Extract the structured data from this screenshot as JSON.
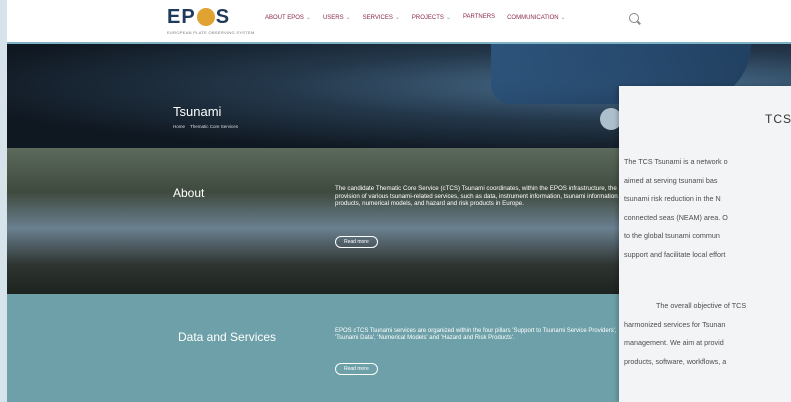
{
  "header": {
    "logo": "EPOS",
    "logo_subtitle": "EUROPEAN PLATE OBSERVING SYSTEM",
    "nav": [
      {
        "label": "ABOUT EPOS",
        "chevron": "⌄"
      },
      {
        "label": "USERS",
        "chevron": "⌄"
      },
      {
        "label": "SERVICES",
        "chevron": "⌄"
      },
      {
        "label": "PROJECTS",
        "chevron": "⌄"
      },
      {
        "label": "PARTNERS",
        "chevron": ""
      },
      {
        "label": "COMMUNICATION",
        "chevron": "⌄"
      }
    ]
  },
  "hero": {
    "title": "Tsunami",
    "breadcrumb": [
      "Home",
      "Thematic Core Services"
    ]
  },
  "about": {
    "title": "About",
    "text": "The candidate Thematic Core Service (cTCS) Tsunami coordinates, within the EPOS infrastructure, the provision of various tsunami-related services, such as data, instrument information, tsunami information products, numerical models, and hazard and risk products in Europe.",
    "button": "Read more"
  },
  "data_services": {
    "title": "Data and Services",
    "text": "EPOS cTCS Tsunami services are organized within the four pillars 'Support to Tsunami Service Providers', 'Tsunami Data', 'Numerical Models' and 'Hazard and Risk Products'.",
    "button": "Read more"
  },
  "popup": {
    "title": "TCS",
    "p1_lines": [
      "The TCS Tsunami is a network o",
      "aimed at serving tsunami bas",
      "tsunami risk reduction in the N",
      "connected seas (NEAM) area. O",
      "to the global tsunami commun",
      "support and facilitate local effort"
    ],
    "p2_lines": [
      "The overall objective of TCS",
      "harmonized services for Tsunan",
      "management. We aim at provid",
      "products, software, workflows, a"
    ]
  }
}
